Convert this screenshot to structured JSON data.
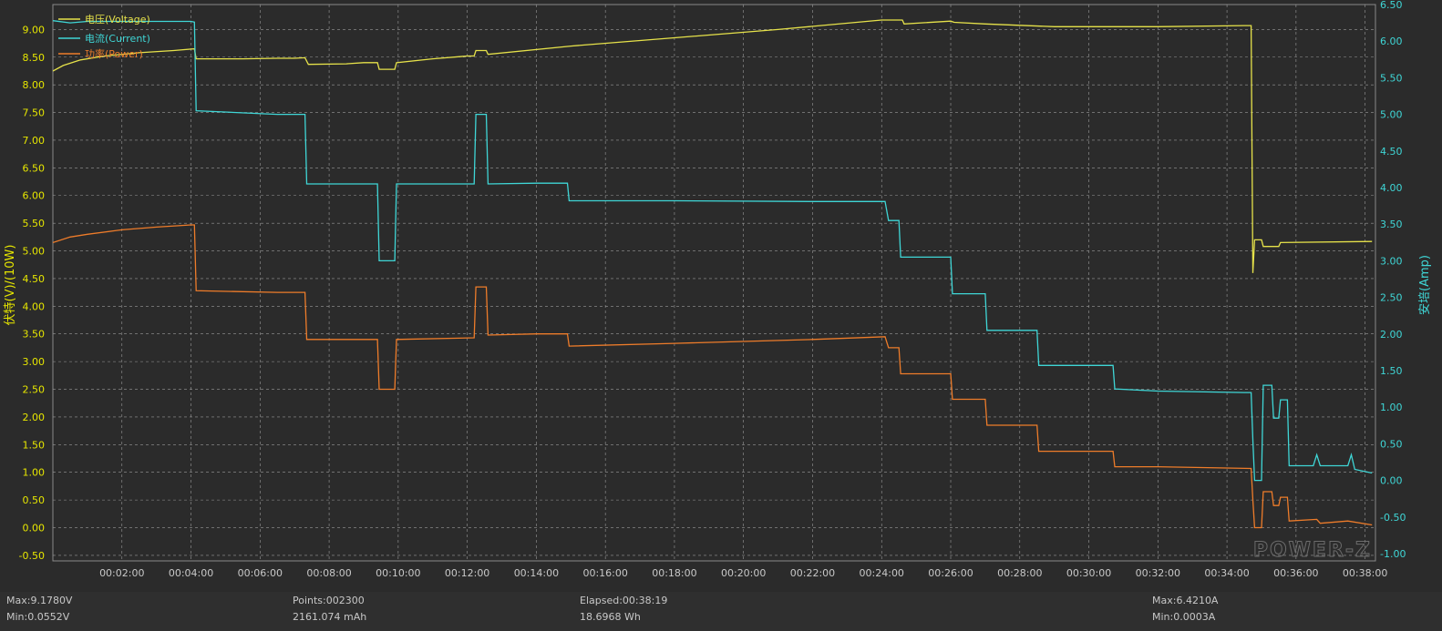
{
  "chart_data": {
    "type": "line",
    "x_unit": "elapsed time",
    "y_left": {
      "label": "伏特(V)/(10W)",
      "ticks": [
        "9.00",
        "8.50",
        "8.00",
        "7.50",
        "7.00",
        "6.50",
        "6.00",
        "5.50",
        "5.00",
        "4.50",
        "4.00",
        "3.50",
        "3.00",
        "2.50",
        "2.00",
        "1.50",
        "1.00",
        "0.50",
        "0.00",
        "-0.50"
      ],
      "range": [
        -0.6,
        9.45
      ],
      "color": "#e6e600"
    },
    "y_right": {
      "label": "安培(Amp)",
      "ticks": [
        "6.50",
        "6.00",
        "5.50",
        "5.00",
        "4.50",
        "4.00",
        "3.50",
        "3.00",
        "2.50",
        "2.00",
        "1.50",
        "1.00",
        "0.50",
        "0.00",
        "-0.50",
        "-1.00"
      ],
      "range": [
        -1.1,
        6.5
      ],
      "color": "#3fd6d6"
    },
    "x_ticks": [
      "00:02:00",
      "00:04:00",
      "00:06:00",
      "00:08:00",
      "00:10:00",
      "00:12:00",
      "00:14:00",
      "00:16:00",
      "00:18:00",
      "00:20:00",
      "00:22:00",
      "00:24:00",
      "00:26:00",
      "00:28:00",
      "00:30:00",
      "00:32:00",
      "00:34:00",
      "00:36:00",
      "00:38:00"
    ],
    "x_range": [
      0,
      38.3
    ],
    "grid": true,
    "legend_position": "top-left",
    "series": [
      {
        "name": "电压(Voltage)",
        "axis": "left",
        "color": "#e6e24a",
        "points": [
          [
            0,
            8.25
          ],
          [
            0.3,
            8.35
          ],
          [
            0.8,
            8.45
          ],
          [
            1.5,
            8.52
          ],
          [
            2.5,
            8.58
          ],
          [
            3.5,
            8.62
          ],
          [
            4.1,
            8.65
          ],
          [
            4.15,
            8.47
          ],
          [
            5.5,
            8.47
          ],
          [
            6.5,
            8.48
          ],
          [
            7.0,
            8.48
          ],
          [
            7.3,
            8.49
          ],
          [
            7.4,
            8.37
          ],
          [
            8.5,
            8.38
          ],
          [
            9.0,
            8.4
          ],
          [
            9.4,
            8.4
          ],
          [
            9.45,
            8.28
          ],
          [
            9.9,
            8.28
          ],
          [
            9.95,
            8.4
          ],
          [
            11.0,
            8.47
          ],
          [
            12.0,
            8.52
          ],
          [
            12.2,
            8.52
          ],
          [
            12.25,
            8.62
          ],
          [
            12.55,
            8.62
          ],
          [
            12.6,
            8.55
          ],
          [
            15.0,
            8.7
          ],
          [
            18.0,
            8.85
          ],
          [
            21.0,
            9.0
          ],
          [
            24.0,
            9.17
          ],
          [
            24.6,
            9.17
          ],
          [
            24.65,
            9.1
          ],
          [
            26.0,
            9.15
          ],
          [
            26.1,
            9.13
          ],
          [
            27.0,
            9.1
          ],
          [
            29.0,
            9.05
          ],
          [
            31.0,
            9.05
          ],
          [
            32.0,
            9.05
          ],
          [
            34.5,
            9.07
          ],
          [
            34.7,
            9.07
          ],
          [
            34.75,
            4.6
          ],
          [
            34.8,
            5.2
          ],
          [
            35.0,
            5.2
          ],
          [
            35.05,
            5.08
          ],
          [
            35.5,
            5.08
          ],
          [
            35.55,
            5.15
          ],
          [
            38.2,
            5.17
          ]
        ]
      },
      {
        "name": "电流(Current)",
        "axis": "right",
        "color": "#3fd6d6",
        "points": [
          [
            0,
            6.28
          ],
          [
            0.5,
            6.25
          ],
          [
            1.0,
            6.27
          ],
          [
            2.0,
            6.27
          ],
          [
            3.0,
            6.27
          ],
          [
            4.0,
            6.27
          ],
          [
            4.1,
            6.26
          ],
          [
            4.15,
            5.05
          ],
          [
            6.5,
            5.0
          ],
          [
            7.3,
            5.0
          ],
          [
            7.35,
            4.05
          ],
          [
            9.4,
            4.05
          ],
          [
            9.45,
            3.0
          ],
          [
            9.9,
            3.0
          ],
          [
            9.95,
            4.05
          ],
          [
            12.2,
            4.05
          ],
          [
            12.25,
            5.0
          ],
          [
            12.55,
            5.0
          ],
          [
            12.6,
            4.05
          ],
          [
            14.0,
            4.06
          ],
          [
            14.9,
            4.06
          ],
          [
            14.95,
            3.82
          ],
          [
            18.0,
            3.82
          ],
          [
            22.0,
            3.81
          ],
          [
            24.1,
            3.81
          ],
          [
            24.2,
            3.55
          ],
          [
            24.5,
            3.55
          ],
          [
            24.55,
            3.05
          ],
          [
            25.0,
            3.05
          ],
          [
            26.0,
            3.05
          ],
          [
            26.05,
            2.55
          ],
          [
            27.0,
            2.55
          ],
          [
            27.05,
            2.05
          ],
          [
            28.5,
            2.05
          ],
          [
            28.55,
            1.57
          ],
          [
            30.0,
            1.57
          ],
          [
            30.7,
            1.57
          ],
          [
            30.75,
            1.25
          ],
          [
            32.0,
            1.22
          ],
          [
            34.5,
            1.2
          ],
          [
            34.7,
            1.2
          ],
          [
            34.75,
            0.55
          ],
          [
            34.8,
            0.0
          ],
          [
            35.0,
            0.0
          ],
          [
            35.05,
            1.3
          ],
          [
            35.3,
            1.3
          ],
          [
            35.35,
            0.85
          ],
          [
            35.5,
            0.85
          ],
          [
            35.55,
            1.1
          ],
          [
            35.75,
            1.1
          ],
          [
            35.8,
            0.2
          ],
          [
            36.5,
            0.2
          ],
          [
            36.6,
            0.35
          ],
          [
            36.7,
            0.2
          ],
          [
            37.5,
            0.2
          ],
          [
            37.6,
            0.35
          ],
          [
            37.7,
            0.15
          ],
          [
            38.2,
            0.1
          ]
        ]
      },
      {
        "name": "功率(Power)",
        "axis": "left",
        "color": "#ee7c2a",
        "points": [
          [
            0,
            5.15
          ],
          [
            0.5,
            5.25
          ],
          [
            1.0,
            5.3
          ],
          [
            2.0,
            5.38
          ],
          [
            3.0,
            5.43
          ],
          [
            4.0,
            5.47
          ],
          [
            4.1,
            5.47
          ],
          [
            4.15,
            4.28
          ],
          [
            6.5,
            4.25
          ],
          [
            7.3,
            4.25
          ],
          [
            7.35,
            3.4
          ],
          [
            9.4,
            3.4
          ],
          [
            9.45,
            2.5
          ],
          [
            9.9,
            2.5
          ],
          [
            9.95,
            3.4
          ],
          [
            12.2,
            3.43
          ],
          [
            12.25,
            4.35
          ],
          [
            12.55,
            4.35
          ],
          [
            12.6,
            3.48
          ],
          [
            14.0,
            3.5
          ],
          [
            14.9,
            3.5
          ],
          [
            14.95,
            3.28
          ],
          [
            18.0,
            3.33
          ],
          [
            22.0,
            3.4
          ],
          [
            24.1,
            3.45
          ],
          [
            24.2,
            3.25
          ],
          [
            24.5,
            3.25
          ],
          [
            24.55,
            2.78
          ],
          [
            26.0,
            2.78
          ],
          [
            26.05,
            2.32
          ],
          [
            27.0,
            2.32
          ],
          [
            27.05,
            1.85
          ],
          [
            28.5,
            1.85
          ],
          [
            28.55,
            1.38
          ],
          [
            30.7,
            1.38
          ],
          [
            30.75,
            1.1
          ],
          [
            32.0,
            1.1
          ],
          [
            34.7,
            1.07
          ],
          [
            34.75,
            0.5
          ],
          [
            34.8,
            0.0
          ],
          [
            35.0,
            0.0
          ],
          [
            35.05,
            0.65
          ],
          [
            35.3,
            0.65
          ],
          [
            35.35,
            0.4
          ],
          [
            35.5,
            0.4
          ],
          [
            35.55,
            0.55
          ],
          [
            35.75,
            0.55
          ],
          [
            35.8,
            0.12
          ],
          [
            36.6,
            0.15
          ],
          [
            36.7,
            0.08
          ],
          [
            37.5,
            0.12
          ],
          [
            38.2,
            0.05
          ]
        ]
      }
    ]
  },
  "watermark": "POWER-Z",
  "footer": {
    "max_voltage": "Max:9.1780V",
    "min_voltage": "Min:0.0552V",
    "points": "Points:002300",
    "capacity_mah": "2161.074 mAh",
    "elapsed": "Elapsed:00:38:19",
    "energy_wh": "18.6968 Wh",
    "max_current": "Max:6.4210A",
    "min_current": "Min:0.0003A"
  }
}
